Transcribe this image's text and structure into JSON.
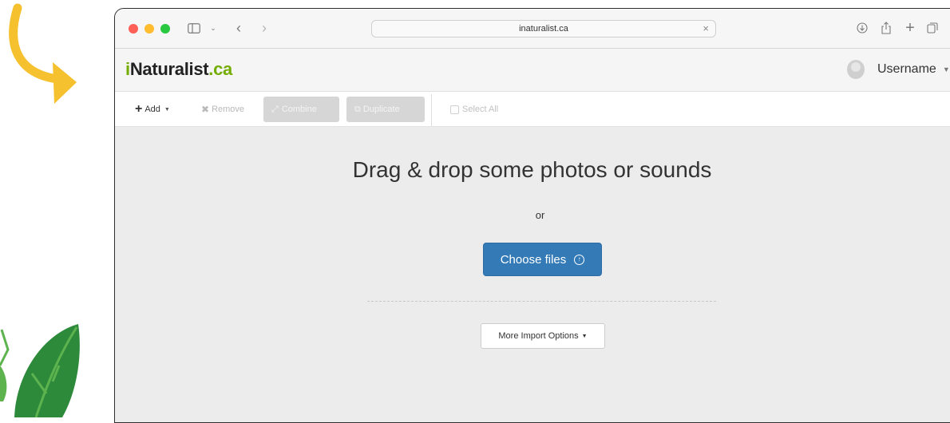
{
  "colors": {
    "accent": "#337ab7",
    "brand_green": "#74ac00",
    "deco_arrow": "#f6c12e",
    "deco_leaf": "#2e8a3b"
  },
  "browser": {
    "url": "inaturalist.ca",
    "icons": [
      "sidebar-icon",
      "chevron-down-icon",
      "back-icon",
      "forward-icon",
      "download-icon",
      "share-icon",
      "new-tab-icon",
      "tabs-overview-icon"
    ]
  },
  "header": {
    "logo_main": "Naturalist",
    "logo_i": "i",
    "logo_suffix": ".ca",
    "username": "Username"
  },
  "toolbar": {
    "add_label": "Add",
    "remove_label": "Remove",
    "combine_label": "Combine",
    "duplicate_label": "Duplicate",
    "select_all_label": "Select All"
  },
  "main": {
    "headline": "Drag & drop some photos or sounds",
    "or_text": "or",
    "choose_files_label": "Choose files",
    "more_options_label": "More Import Options"
  }
}
